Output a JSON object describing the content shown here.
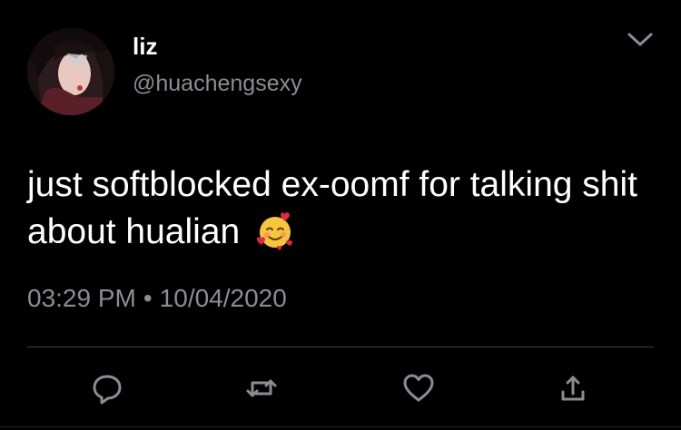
{
  "user": {
    "display_name": "liz",
    "handle": "@huachengsexy"
  },
  "tweet": {
    "text": "just softblocked ex-oomf for talking shit about hualian",
    "emoji": "smiling-face-with-hearts",
    "time": "03:29 PM",
    "separator": "•",
    "date": "10/04/2020"
  },
  "actions": [
    "reply",
    "retweet",
    "like",
    "share"
  ],
  "colors": {
    "background": "#000000",
    "text": "#ffffff",
    "secondary_text": "#8b8d90",
    "icon": "#8b8d90",
    "divider": "#3a3c3f"
  }
}
